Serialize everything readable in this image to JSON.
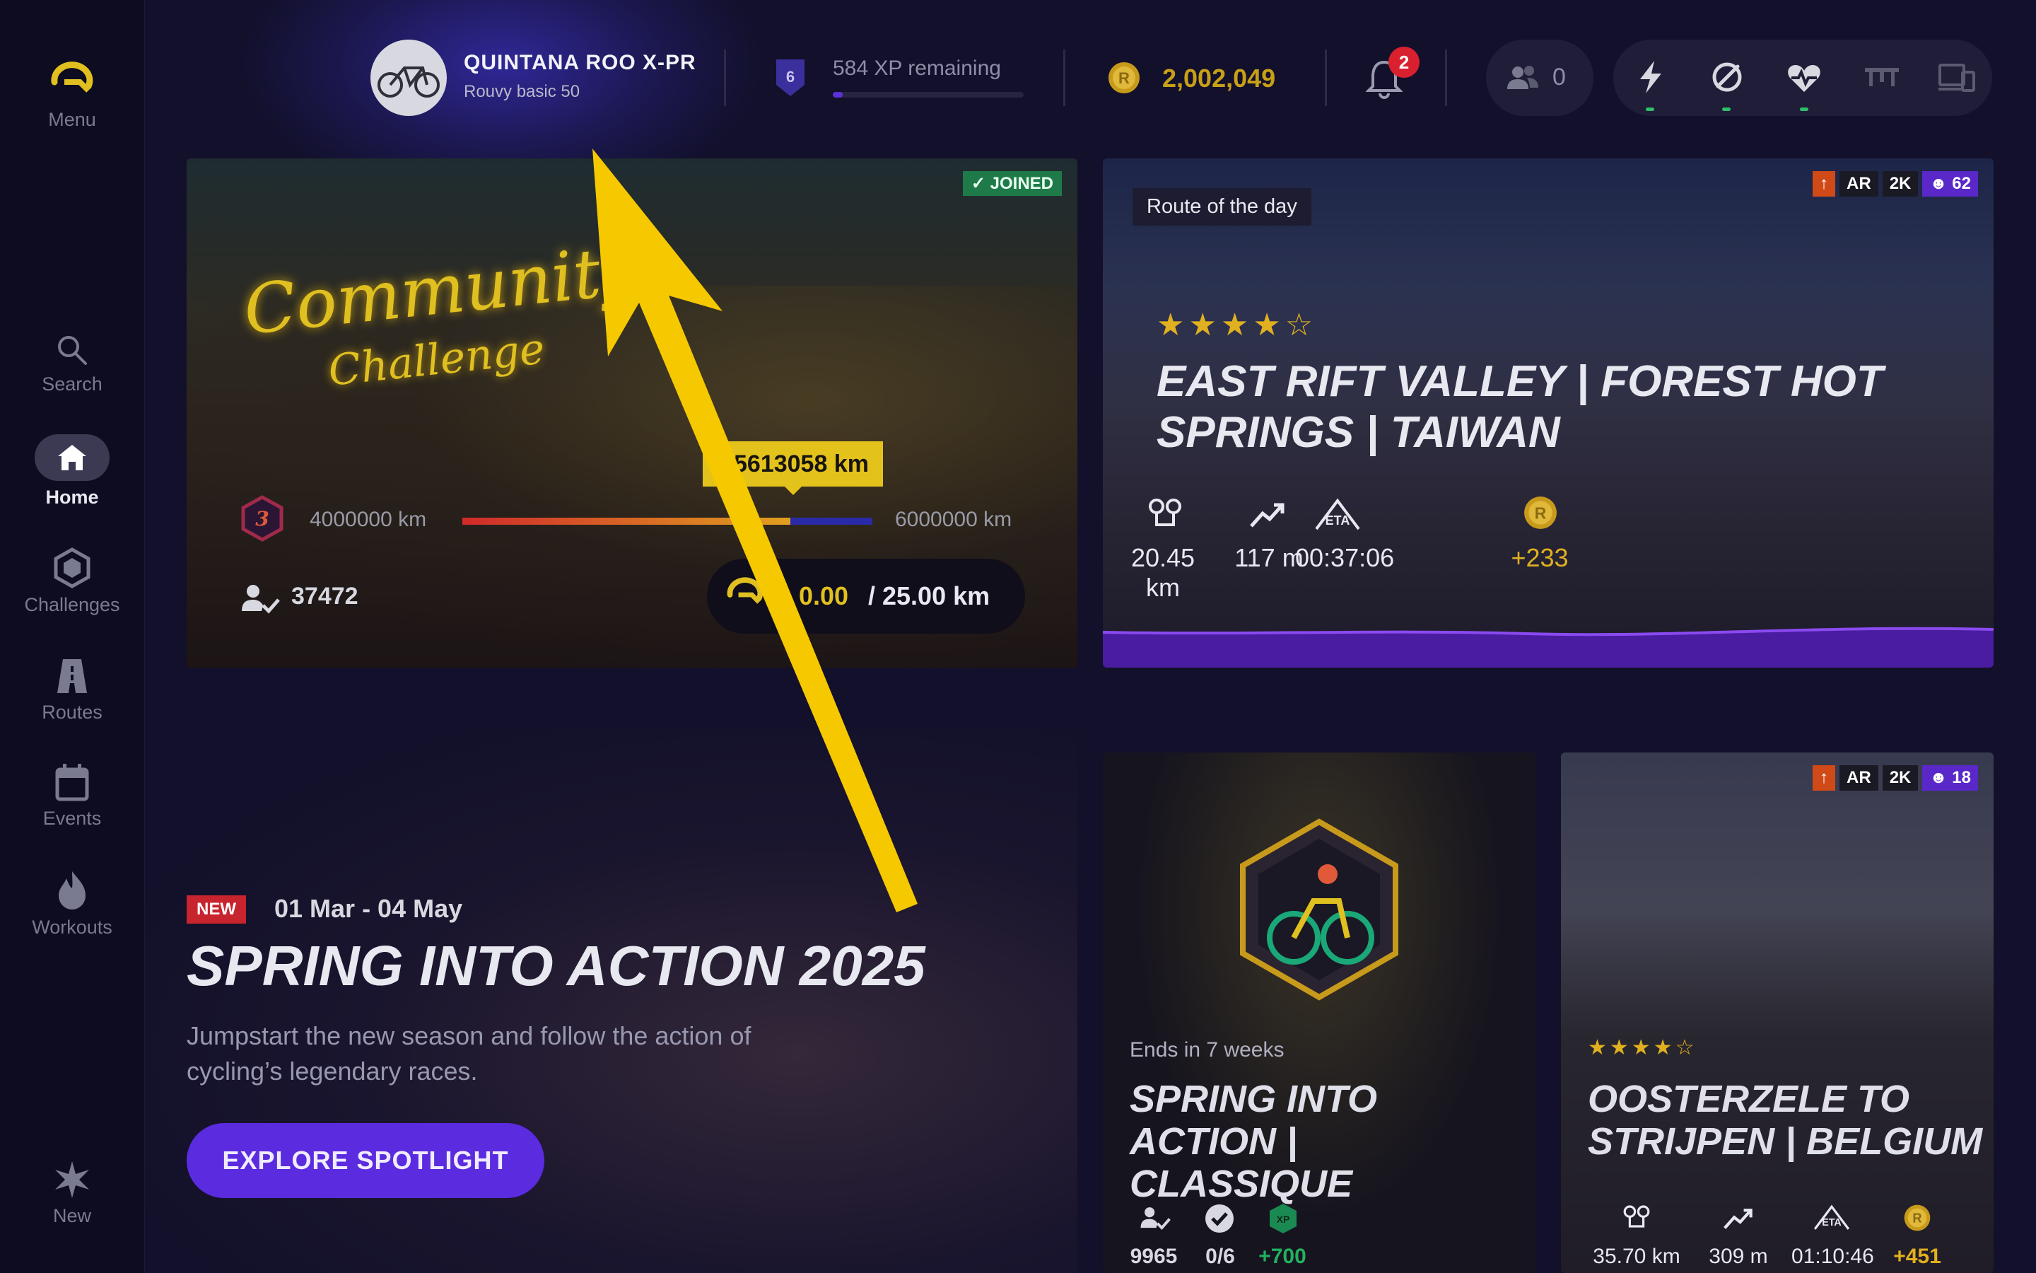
{
  "sidebar": {
    "menu_label": "Menu",
    "items": [
      {
        "label": "Search",
        "icon": "search-icon"
      },
      {
        "label": "Home",
        "icon": "home-icon"
      },
      {
        "label": "Challenges",
        "icon": "hexagon-icon"
      },
      {
        "label": "Routes",
        "icon": "road-icon"
      },
      {
        "label": "Events",
        "icon": "calendar-icon"
      },
      {
        "label": "Workouts",
        "icon": "flame-icon"
      }
    ],
    "new_label": "New"
  },
  "topbar": {
    "bike_name": "QUINTANA ROO X-PR",
    "bike_subtitle": "Rouvy basic 50",
    "level": "6",
    "xp_remaining": "584 XP remaining",
    "xp_progress_fraction": 0.05,
    "coins": "2,002,049",
    "notifications": "2",
    "friends_count": "0",
    "sensors": [
      "power-icon",
      "cadence-icon",
      "heart-rate-icon",
      "trainer-icon",
      "devices-icon"
    ]
  },
  "community_challenge": {
    "joined": "✓ JOINED",
    "title_line1": "Community",
    "title_line2": "Challenge",
    "level": "3",
    "current_km": "5613058 km",
    "range_min": "4000000 km",
    "range_max": "6000000 km",
    "progress_fraction": 0.8,
    "participants": "37472",
    "goal_done": "0.00",
    "goal_total": "/ 25.00 km"
  },
  "route_of_day": {
    "tag": "Route of the day",
    "badges": [
      "AR",
      "2K"
    ],
    "badge_count": "62",
    "rating": 4.5,
    "stars": "★★★★☆",
    "title": "EAST RIFT VALLEY | FOREST HOT SPRINGS | TAIWAN",
    "distance": "20.45 km",
    "elevation": "117 m",
    "eta": "00:37:06",
    "coins": "+233"
  },
  "spotlight": {
    "badge": "NEW",
    "dates": "01 Mar - 04 May",
    "title": "SPRING INTO ACTION 2025",
    "description": "Jumpstart the new season and follow the action of cycling’s legendary races.",
    "button": "EXPLORE SPOTLIGHT"
  },
  "challenge_card": {
    "ends": "Ends in 7 weeks",
    "title": "SPRING INTO ACTION | CLASSIQUE",
    "participants": "9965",
    "completed": "0/6",
    "xp": "+700"
  },
  "route_card": {
    "badges": [
      "AR",
      "2K"
    ],
    "badge_count": "18",
    "rating": 4.5,
    "stars": "★★★★☆",
    "title": "OOSTERZELE TO STRIJPEN | BELGIUM",
    "distance": "35.70 km",
    "elevation": "309 m",
    "eta": "01:10:46",
    "coins": "+451"
  },
  "colors": {
    "accent": "#5b2be0",
    "gold": "#e0c020",
    "annotation_arrow": "#f5c800"
  }
}
